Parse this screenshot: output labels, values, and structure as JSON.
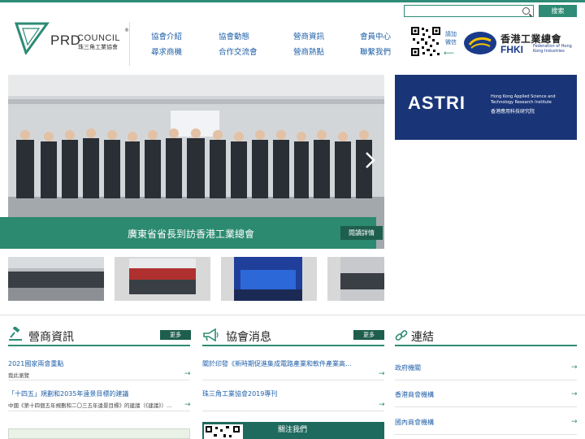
{
  "header": {
    "search": {
      "placeholder": "",
      "button": "搜索"
    },
    "logo": {
      "prd": "PRD",
      "council": "COUNCIL",
      "reg": "®",
      "subtitle": "珠三角工業協會"
    },
    "nav": [
      {
        "label": "協會介紹"
      },
      {
        "label": "協會動態"
      },
      {
        "label": "營商資訊"
      },
      {
        "label": "會員中心"
      },
      {
        "label": "尋求商機"
      },
      {
        "label": "合作交流會"
      },
      {
        "label": "營商熱點"
      },
      {
        "label": "聯繫我們"
      }
    ],
    "qr_label": "請加微信",
    "fhki": {
      "cn": "香港工業總會",
      "en": "FHKI",
      "en_small": "Federation of Hong Kong Industries"
    }
  },
  "hero": {
    "caption": "廣東省省長到訪香港工業總會",
    "more": "閱讀詳情",
    "next_icon": "chevron-right-icon"
  },
  "ad": {
    "title": "ASTRI",
    "sub_en": "Hong Kong Applied Science and Technology Research Institute",
    "sub_cn": "香港應用科技研究院"
  },
  "business": {
    "title": "營商資訊",
    "more": "更多",
    "icon": "gavel-icon",
    "items": [
      {
        "title": "2021國家兩會重點",
        "sub": "我此瀏覽"
      },
      {
        "title": "「十四五」規劃和2035年遠景目標的建議",
        "sub": "中國《第十四個五年規劃和二〇三五年遠景目標》的建議（《建議》）..."
      }
    ]
  },
  "news": {
    "title": "協會消息",
    "more": "更多",
    "icon": "megaphone-icon",
    "items": [
      {
        "title": "關於印發《新時期促進集成電路產業和軟件產業高..."
      },
      {
        "title": "珠三角工業協會2019專刊"
      }
    ],
    "wechat": "關注我們"
  },
  "links": {
    "title": "連結",
    "icon": "link-icon",
    "items": [
      {
        "label": "政府機關"
      },
      {
        "label": "香港商會機構"
      },
      {
        "label": "國內商會機構"
      }
    ]
  },
  "colors": {
    "brand": "#2e8b76",
    "dark_green": "#1e5e4d",
    "link": "#1f5fa8"
  }
}
